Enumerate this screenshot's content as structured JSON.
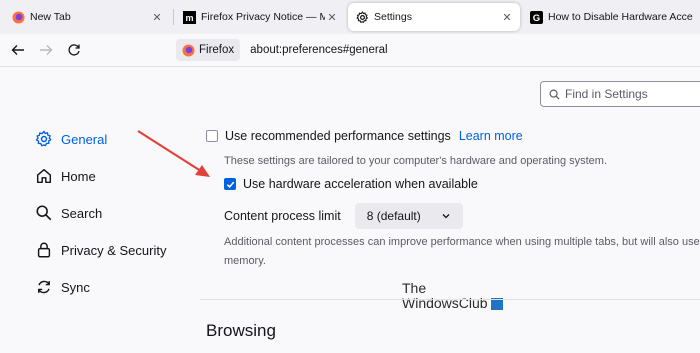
{
  "tabs": [
    {
      "title": "New Tab",
      "favicon": "firefox-icon"
    },
    {
      "title": "Firefox Privacy Notice — Mozilla",
      "favicon": "mozilla-icon"
    },
    {
      "title": "Settings",
      "favicon": "gear-icon"
    },
    {
      "title": "How to Disable Hardware Acce",
      "favicon": "google-icon"
    }
  ],
  "tab_close_glyph": "✕",
  "urlbar": {
    "identity_label": "Firefox",
    "url": "about:preferences#general"
  },
  "search": {
    "placeholder": "Find in Settings"
  },
  "sidebar": {
    "items": [
      {
        "label": "General",
        "icon": "gear-icon"
      },
      {
        "label": "Home",
        "icon": "home-icon"
      },
      {
        "label": "Search",
        "icon": "search-icon"
      },
      {
        "label": "Privacy & Security",
        "icon": "lock-icon"
      },
      {
        "label": "Sync",
        "icon": "sync-icon"
      }
    ]
  },
  "performance": {
    "recommended_label": "Use recommended performance settings",
    "recommended_checked": false,
    "learn_more": "Learn more",
    "recommended_desc": "These settings are tailored to your computer's hardware and operating system.",
    "hw_accel_label": "Use hardware acceleration when available",
    "hw_accel_checked": true,
    "content_process_label": "Content process limit",
    "content_process_value": "8 (default)",
    "content_process_desc_line1": "Additional content processes can improve performance when using multiple tabs, but will also use more",
    "content_process_desc_line2": "memory."
  },
  "browsing_heading": "Browsing",
  "watermark": {
    "line1": "The",
    "line2": "WindowsClub"
  },
  "colors": {
    "accent": "#0061e0",
    "annotation_arrow": "#e0413a"
  }
}
